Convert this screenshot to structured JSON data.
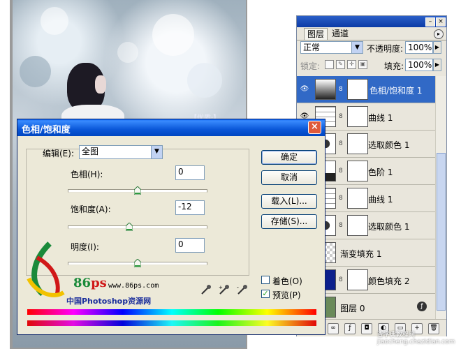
{
  "photo": {
    "overlay_text": "【优质·】"
  },
  "layers_panel": {
    "tabs": [
      "图层",
      "通道"
    ],
    "blend_mode": "正常",
    "opacity_label": "不透明度:",
    "opacity_value": "100%",
    "lock_label": "锁定:",
    "fill_label": "填充:",
    "fill_value": "100%",
    "layers": [
      {
        "name": "色相/饱和度 1",
        "selected": true,
        "visible": true
      },
      {
        "name": "曲线 1",
        "selected": false,
        "visible": true
      },
      {
        "name": "选取颜色 1",
        "selected": false,
        "visible": true
      },
      {
        "name": "色阶 1",
        "selected": false,
        "visible": true
      },
      {
        "name": "曲线 1",
        "selected": false,
        "visible": true
      },
      {
        "name": "选取颜色 1",
        "selected": false,
        "visible": true
      },
      {
        "name": "渐变填充 1",
        "selected": false,
        "visible": true
      },
      {
        "name": "颜色填充 2",
        "selected": false,
        "visible": true
      },
      {
        "name": "图层 0",
        "selected": false,
        "visible": true
      }
    ]
  },
  "dialog": {
    "title": "色相/饱和度",
    "edit_label": "编辑(E):",
    "edit_value": "全图",
    "hue_label": "色相(H):",
    "hue_value": "0",
    "saturation_label": "饱和度(A):",
    "saturation_value": "-12",
    "lightness_label": "明度(I):",
    "lightness_value": "0",
    "ok_label": "确定",
    "cancel_label": "取消",
    "load_label": "载入(L)...",
    "save_label": "存储(S)...",
    "colorize_label": "着色(O)",
    "colorize_checked": false,
    "preview_label": "预览(P)",
    "preview_checked": true
  },
  "watermark": {
    "brand_big": "86",
    "brand_small": "ps",
    "url": "www.86ps.com",
    "chinese": "中国Photoshop资源网",
    "bottom_site": "查字典教程网 jiaocheng.chazidian.com"
  },
  "colors": {
    "selection_blue": "#3169c6",
    "xp_title_blue": "#0058ee",
    "panel_bg": "#e9e6dc",
    "dialog_bg": "#ece9d8"
  }
}
